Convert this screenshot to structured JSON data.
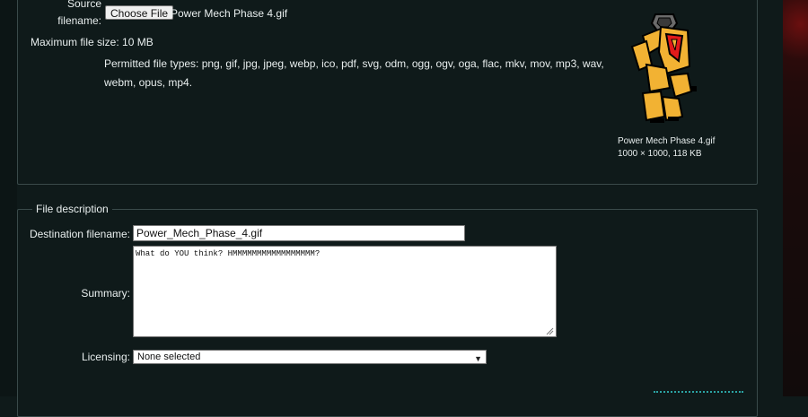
{
  "upload": {
    "source_label_line1": "Source",
    "source_label_line2": "filename:",
    "choose_button": "Choose File",
    "chosen_file": "Power Mech Phase 4.gif",
    "max_size": "Maximum file size: 10 MB",
    "permitted_line1": "Permitted file types: png, gif, jpg, jpeg, webp, ico, pdf, svg, odm, ogg, ogv, oga, flac, mkv, mov, mp3, wav,",
    "permitted_line2": "webm, opus, mp4."
  },
  "preview": {
    "image_name": "power-mech-robot-icon",
    "caption_name": "Power Mech Phase 4.gif",
    "caption_info": "1000 × 1000, 118 KB",
    "colors": {
      "body": "#f2b233",
      "shield": "#e21a1a",
      "outline": "#000000",
      "head": "#6b6b6b"
    }
  },
  "description": {
    "legend": "File description",
    "dest_label": "Destination filename:",
    "dest_value": "Power_Mech_Phase_4.gif",
    "summary_label": "Summary:",
    "summary_value": "What do YOU think? HMMMMMMMMMMMMMMMMM?",
    "licensing_label": "Licensing:",
    "licensing_value": "None selected"
  }
}
